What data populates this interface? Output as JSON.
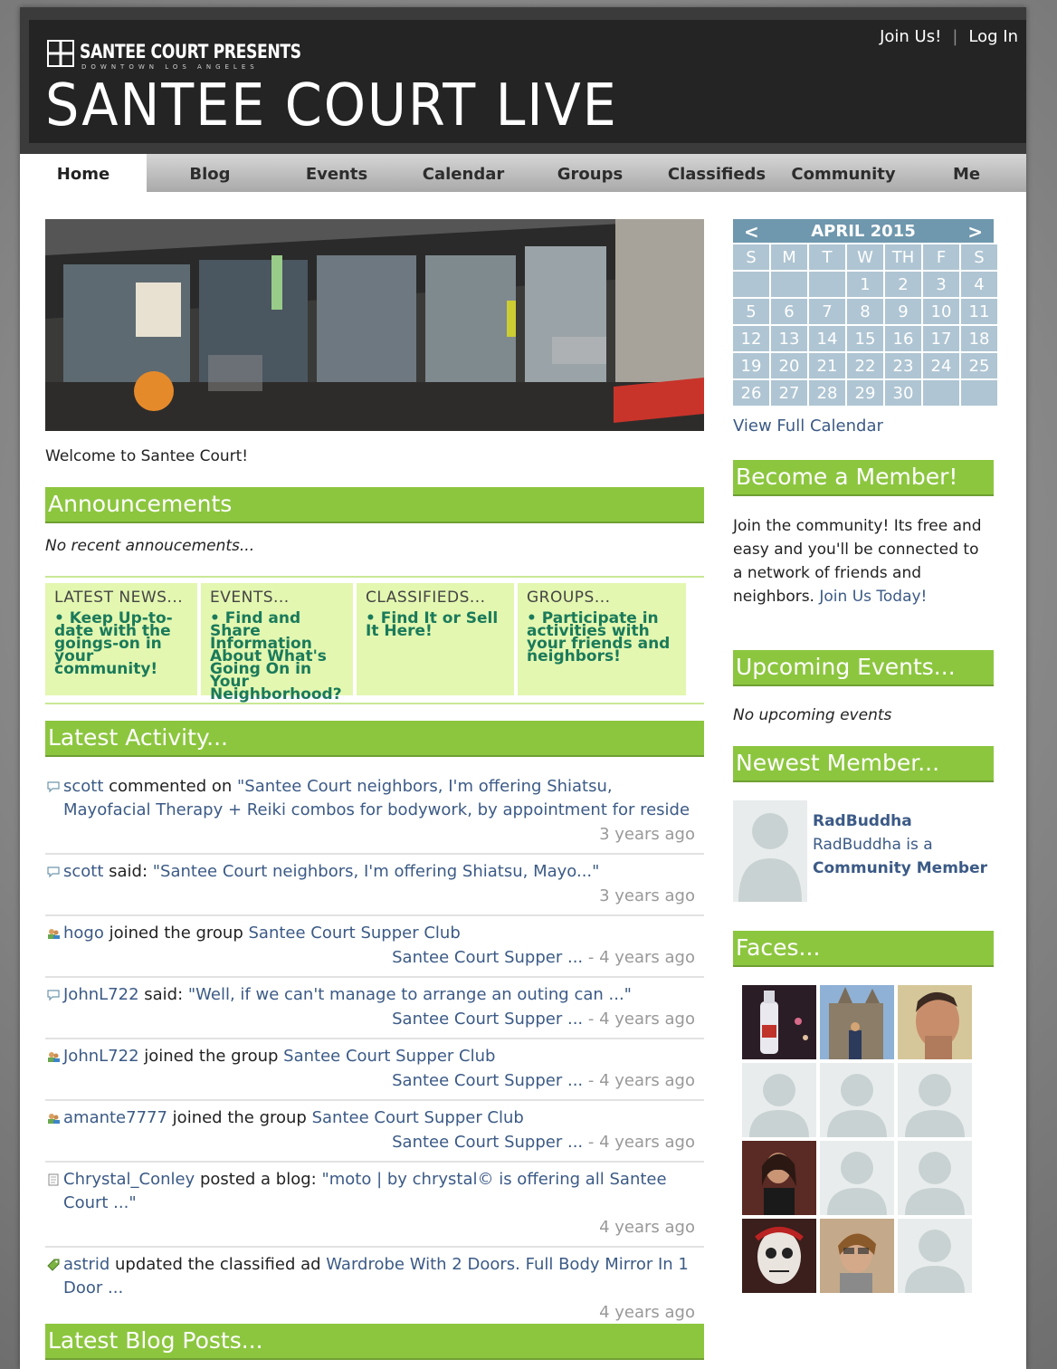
{
  "header": {
    "brand": "SANTEE COURT PRESENTS",
    "brand_sub": "DOWNTOWN LOS ANGELES",
    "site_title": "SANTEE COURT LIVE",
    "join": "Join Us!",
    "separator": "|",
    "login": "Log In"
  },
  "nav": [
    "Home",
    "Blog",
    "Events",
    "Calendar",
    "Groups",
    "Classifieds",
    "Community",
    "Me"
  ],
  "welcome": "Welcome to Santee Court!",
  "announcements": {
    "title": "Announcements",
    "empty": "No recent annoucements..."
  },
  "features": [
    {
      "title": "LATEST NEWS...",
      "body": "• Keep Up-to-date with the goings-on in your community!"
    },
    {
      "title": "EVENTS...",
      "body": "• Find and Share Information About What's Going On in Your Neighborhood?"
    },
    {
      "title": "CLASSIFIEDS...",
      "body": "• Find It or Sell It Here!"
    },
    {
      "title": "GROUPS...",
      "body": "• Participate in activities with your friends and neighbors!"
    }
  ],
  "activity": {
    "title": "Latest Activity...",
    "items": [
      {
        "icon": "comment-icon",
        "user": "scott",
        "action": " commented on ",
        "target": "\"Santee Court neighbors, I'm offering Shiatsu, Mayofacial Therapy + Reiki combos for bodywork, by appointment for reside",
        "group": "",
        "dash": "",
        "when": "3 years ago"
      },
      {
        "icon": "comment-icon",
        "user": "scott",
        "action": " said: ",
        "target": "\"Santee Court neighbors, I'm offering Shiatsu, Mayo...\"",
        "group": "",
        "dash": "",
        "when": "3 years ago"
      },
      {
        "icon": "group-icon",
        "user": "hogo",
        "action": " joined the group ",
        "target": "Santee Court Supper Club",
        "group": "Santee Court Supper ...",
        "dash": " - ",
        "when": "4 years ago"
      },
      {
        "icon": "comment-icon",
        "user": "JohnL722",
        "action": " said: ",
        "target": "\"Well, if we can't manage to arrange an outing can ...\"",
        "group": "Santee Court Supper ...",
        "dash": " - ",
        "when": "4 years ago"
      },
      {
        "icon": "group-icon",
        "user": "JohnL722",
        "action": " joined the group ",
        "target": "Santee Court Supper Club",
        "group": "Santee Court Supper ...",
        "dash": " - ",
        "when": "4 years ago"
      },
      {
        "icon": "group-icon",
        "user": "amante7777",
        "action": " joined the group ",
        "target": "Santee Court Supper Club",
        "group": "Santee Court Supper ...",
        "dash": " - ",
        "when": "4 years ago"
      },
      {
        "icon": "blog-icon",
        "user": "Chrystal_Conley",
        "action": " posted a blog: ",
        "target": "\"moto | by chrystal© is offering all Santee Court ...\"",
        "group": "",
        "dash": "",
        "when": "4 years ago"
      },
      {
        "icon": "classified-icon",
        "user": "astrid",
        "action": " updated the classified ad ",
        "target": "Wardrobe With 2 Doors. Full Body Mirror In 1 Door ...",
        "group": "",
        "dash": "",
        "when": "4 years ago"
      }
    ]
  },
  "blog": {
    "title": "Latest Blog Posts..."
  },
  "calendar": {
    "month": "APRIL 2015",
    "prev": "<",
    "next": ">",
    "days": [
      "S",
      "M",
      "T",
      "W",
      "TH",
      "F",
      "S"
    ],
    "cells": [
      "",
      "",
      "",
      "1",
      "2",
      "3",
      "4",
      "5",
      "6",
      "7",
      "8",
      "9",
      "10",
      "11",
      "12",
      "13",
      "14",
      "15",
      "16",
      "17",
      "18",
      "19",
      "20",
      "21",
      "22",
      "23",
      "24",
      "25",
      "26",
      "27",
      "28",
      "29",
      "30",
      "",
      ""
    ],
    "view_full": "View Full Calendar"
  },
  "become_member": {
    "title": "Become a Member!",
    "text": "Join the community! Its free and easy and you'll be connected to a network of friends and neighbors.",
    "link": "Join Us Today!"
  },
  "upcoming": {
    "title": "Upcoming Events...",
    "empty": "No upcoming events"
  },
  "newest": {
    "title": "Newest Member...",
    "name": "RadBuddha",
    "desc": "RadBuddha is a",
    "role": "Community Member"
  },
  "faces": {
    "title": "Faces..."
  },
  "colors": {
    "green": "#8cc63f",
    "link": "#3b5a86",
    "calendar": "#6f97ad"
  }
}
